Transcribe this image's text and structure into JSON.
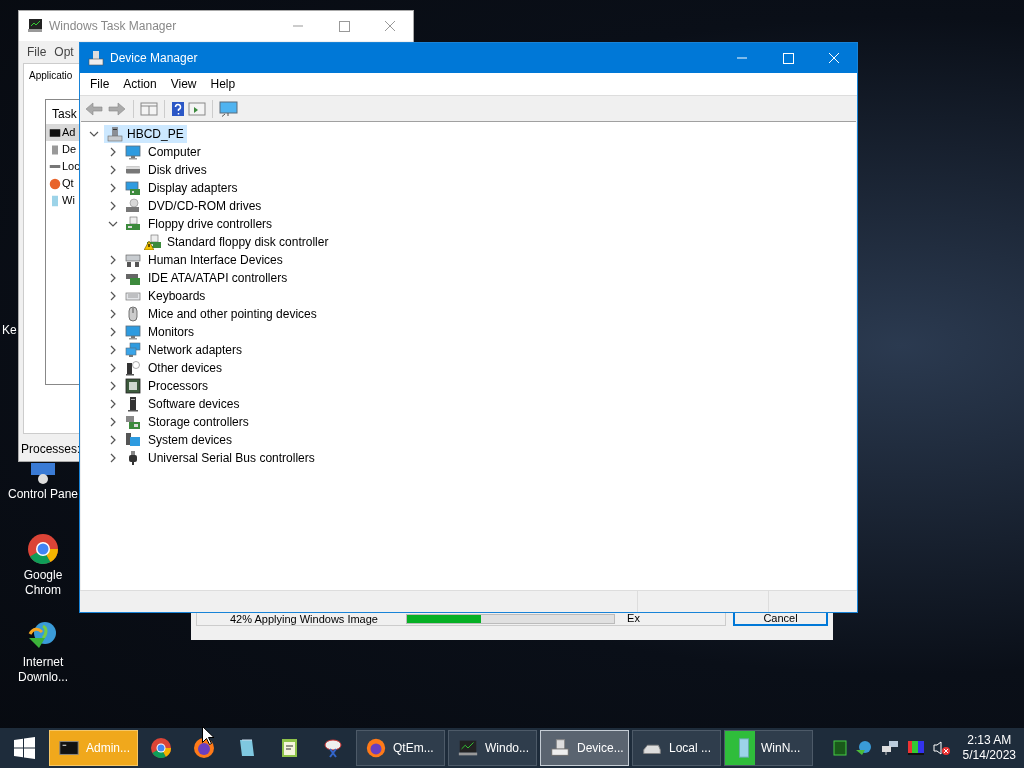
{
  "desktop_icons": [
    {
      "label": "Ke"
    },
    {
      "label": "Control Pane"
    },
    {
      "label": "Google Chrom"
    },
    {
      "label": "Internet Downlo..."
    }
  ],
  "task_manager": {
    "title": "Windows Task Manager",
    "menu": [
      "File",
      "Opt"
    ],
    "tab": "Applicatio",
    "column": "Task",
    "rows": [
      {
        "label": "Ad",
        "selected": true
      },
      {
        "label": "De",
        "selected": false
      },
      {
        "label": "Loc",
        "selected": false
      },
      {
        "label": "Qt",
        "selected": false
      },
      {
        "label": "Wi",
        "selected": false
      }
    ],
    "status": "Processes:"
  },
  "setup_window": {
    "status": "42% Applying Windows Image",
    "level": 0.36,
    "buttons": [
      {
        "label": "Ex",
        "focused": false
      },
      {
        "label": "Cancel",
        "focused": true
      }
    ]
  },
  "device_manager": {
    "title": "Device Manager",
    "menu": [
      "File",
      "Action",
      "View",
      "Help"
    ],
    "tree": {
      "label": "HBCD_PE",
      "expanded": true,
      "selected": true,
      "children": [
        {
          "label": "Computer",
          "expanded": false
        },
        {
          "label": "Disk drives",
          "expanded": false
        },
        {
          "label": "Display adapters",
          "expanded": false
        },
        {
          "label": "DVD/CD-ROM drives",
          "expanded": false
        },
        {
          "label": "Floppy drive controllers",
          "expanded": true,
          "children": [
            {
              "label": "Standard floppy disk controller",
              "warning": true
            }
          ]
        },
        {
          "label": "Human Interface Devices",
          "expanded": false
        },
        {
          "label": "IDE ATA/ATAPI controllers",
          "expanded": false
        },
        {
          "label": "Keyboards",
          "expanded": false
        },
        {
          "label": "Mice and other pointing devices",
          "expanded": false
        },
        {
          "label": "Monitors",
          "expanded": false
        },
        {
          "label": "Network adapters",
          "expanded": false
        },
        {
          "label": "Other devices",
          "expanded": false
        },
        {
          "label": "Processors",
          "expanded": false
        },
        {
          "label": "Software devices",
          "expanded": false
        },
        {
          "label": "Storage controllers",
          "expanded": false
        },
        {
          "label": "System devices",
          "expanded": false
        },
        {
          "label": "Universal Serial Bus controllers",
          "expanded": false
        }
      ]
    }
  },
  "taskbar": {
    "items": [
      {
        "kind": "window",
        "label": "Admin...",
        "attention": true,
        "active": false
      },
      {
        "kind": "pinned"
      },
      {
        "kind": "pinned"
      },
      {
        "kind": "pinned"
      },
      {
        "kind": "pinned"
      },
      {
        "kind": "pinned"
      },
      {
        "kind": "window",
        "label": "QtEm...",
        "attention": false,
        "active": false
      },
      {
        "kind": "window",
        "label": "Windo...",
        "attention": false,
        "active": false
      },
      {
        "kind": "window",
        "label": "Device...",
        "attention": false,
        "active": true
      },
      {
        "kind": "window",
        "label": "Local ...",
        "attention": false,
        "active": false
      },
      {
        "kind": "window",
        "label": "WinN...",
        "attention": false,
        "active": false,
        "level": 0.35
      }
    ],
    "clock": {
      "time": "2:13 AM",
      "date": "5/14/2023"
    }
  }
}
